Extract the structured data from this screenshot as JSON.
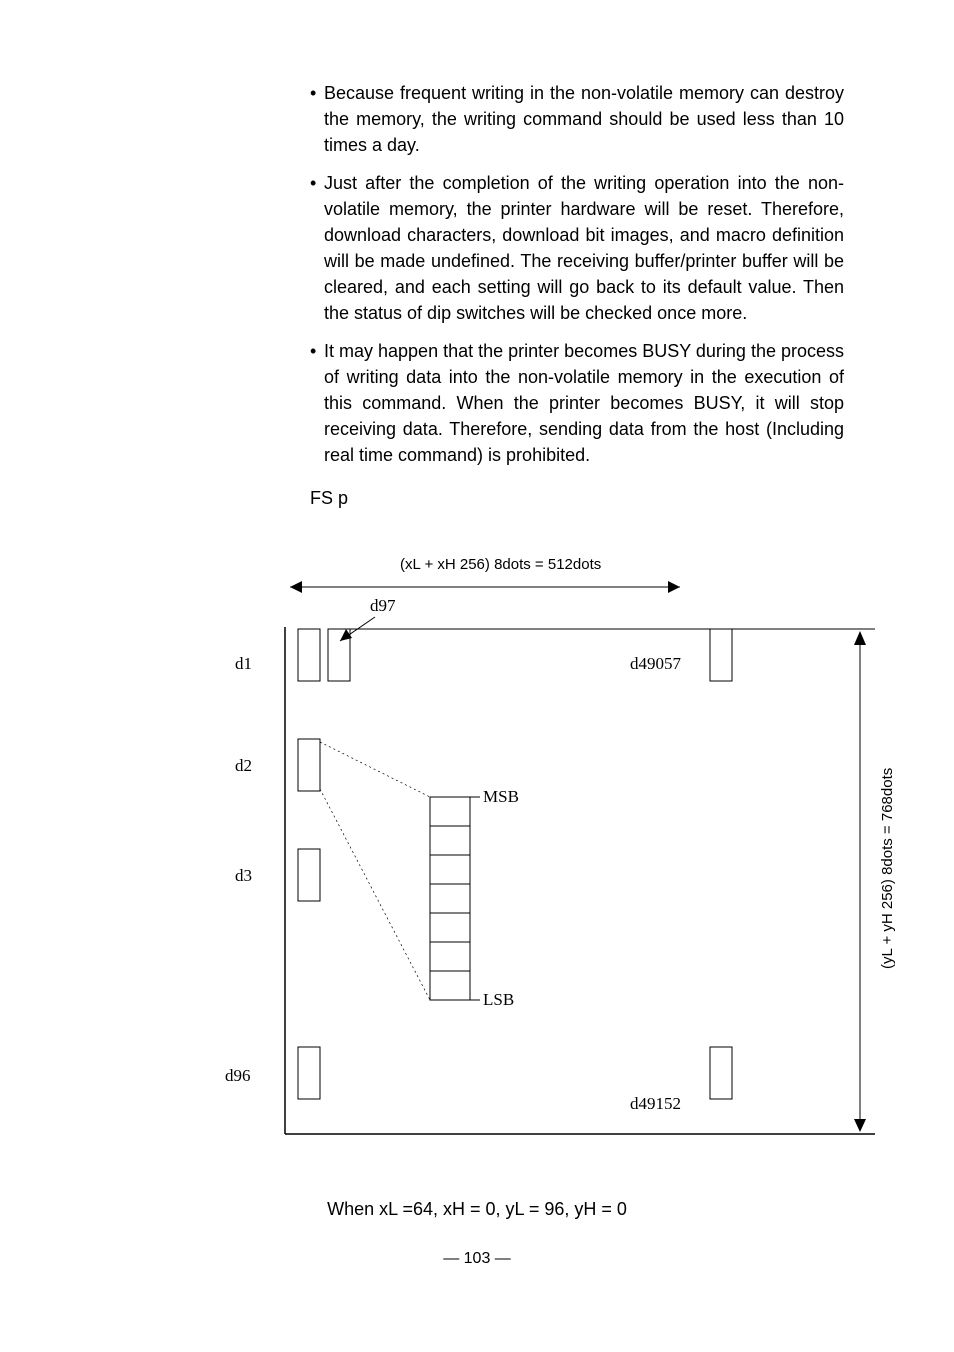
{
  "bullets": [
    "Because frequent writing in the non-volatile memory can destroy the memory, the writing command should be used less than 10 times a day.",
    "Just after the completion of the writing operation into the non-volatile memory, the printer hardware will be reset. Therefore, download characters, download bit images, and macro definition will be made undefined. The receiving buffer/printer buffer will be cleared, and each setting will go back to its default value. Then the status of dip switches will be checked once more.",
    "It may happen that the printer becomes BUSY during the process of writing data into the non-volatile memory in the execution of this command. When the printer becomes BUSY, it will stop receiving data. Therefore, sending data from the host (Including real time command) is prohibited."
  ],
  "fsp_label": "FS p",
  "diagram": {
    "top_label": "(xL + xH    256)    8dots = 512dots",
    "right_label": "(yL + yH    256)    8dots = 768dots",
    "d1": "d1",
    "d2": "d2",
    "d3": "d3",
    "d96": "d96",
    "d97": "d97",
    "d49057": "d49057",
    "d49152": "d49152",
    "msb": "MSB",
    "lsb": "LSB"
  },
  "caption": "When xL =64, xH = 0, yL = 96, yH = 0",
  "page_number": "— 103 —"
}
